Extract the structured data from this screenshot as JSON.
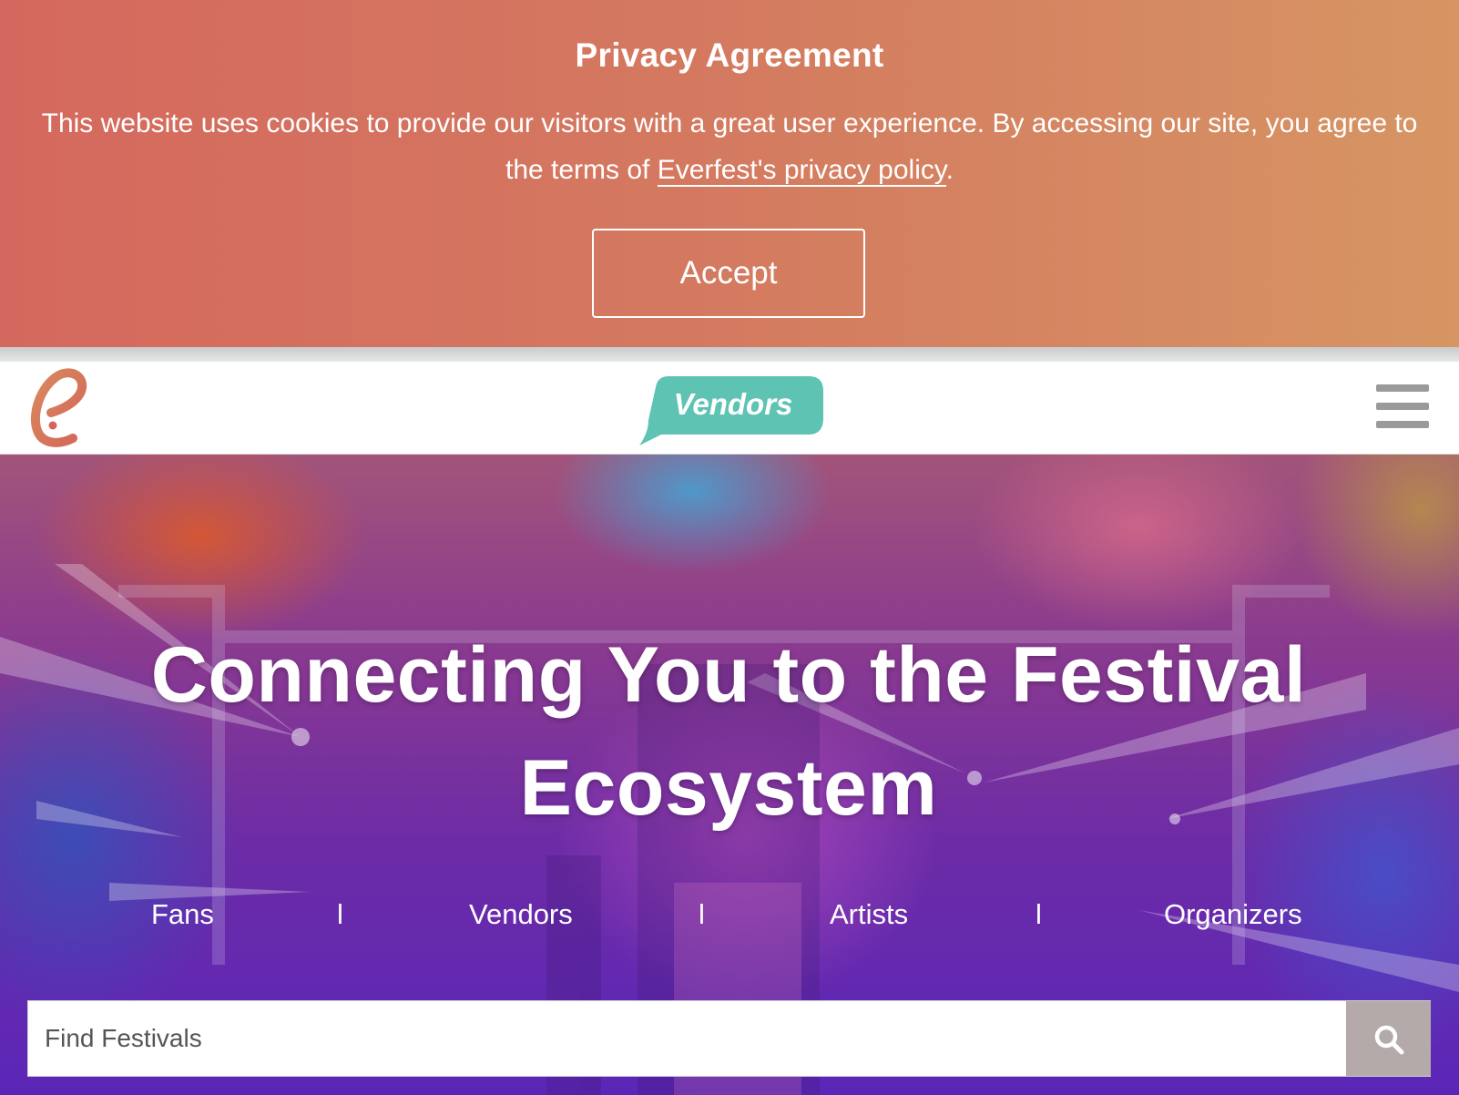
{
  "cookie_banner": {
    "title": "Privacy Agreement",
    "text_before_link": "This website uses cookies to provide our visitors with a great user experience. By accessing our site, you agree to the terms of ",
    "link_text": "Everfest's privacy policy",
    "text_after_link": ".",
    "accept_label": "Accept",
    "colors": {
      "gradient_start": "#d5685e",
      "gradient_end": "#d69563"
    }
  },
  "header": {
    "logo_icon": "everfest-e-logo",
    "badge_label": "Vendors",
    "badge_color": "#5fc3b3",
    "menu_icon": "hamburger-menu-icon"
  },
  "hero": {
    "title": "Connecting You to the Festival Ecosystem",
    "audience_links": [
      "Fans",
      "Vendors",
      "Artists",
      "Organizers"
    ],
    "separator": "l",
    "search": {
      "placeholder": "Find Festivals",
      "button_icon": "search-icon"
    }
  }
}
